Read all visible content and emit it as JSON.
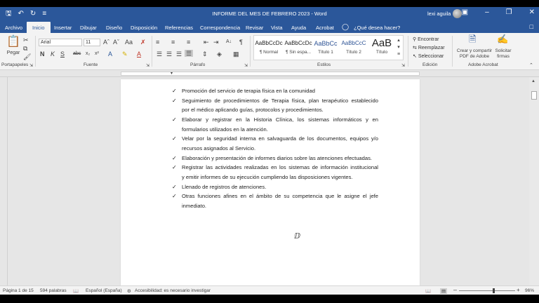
{
  "window": {
    "title": "INFORME DEL MES DE FEBRERO  2023  -  Word",
    "user": "lexi aguila"
  },
  "tabs": [
    "Archivo",
    "Inicio",
    "Insertar",
    "Dibujar",
    "Diseño",
    "Disposición",
    "Referencias",
    "Correspondencia",
    "Revisar",
    "Vista",
    "Ayuda",
    "Acrobat"
  ],
  "tell_me": "¿Qué desea hacer?",
  "ribbon": {
    "paste": "Pegar",
    "font_name": "Arial",
    "font_size": "11",
    "styles": [
      {
        "preview": "AaBbCcDc",
        "name": "¶ Normal"
      },
      {
        "preview": "AaBbCcDc",
        "name": "¶ Sin espa..."
      },
      {
        "preview": "AaBbCc",
        "name": "Título 1"
      },
      {
        "preview": "AaBbCcC",
        "name": "Título 2"
      },
      {
        "preview": "AaB",
        "name": "Título"
      }
    ],
    "edit": {
      "find": "Encontrar",
      "replace": "Reemplazar",
      "select": "Seleccionar"
    },
    "acrobat": {
      "create": "Crear y compartir",
      "create2": "PDF de Adobe",
      "request": "Solicitar",
      "request2": "firmas"
    },
    "groups": {
      "clipboard": "Portapapeles",
      "font": "Fuente",
      "paragraph": "Párrafo",
      "styles": "Estilos",
      "editing": "Edición",
      "adobe": "Adobe Acrobat"
    }
  },
  "document": {
    "bullets": [
      {
        "lines": [
          "Promoción del servicio de terapia física en la comunidad"
        ]
      },
      {
        "lines": [
          "Seguimiento de procedimientos de Terapia física, plan terapéutico establecido",
          "por el médico aplicando guías, protocolos y procedimientos."
        ]
      },
      {
        "lines": [
          "Elaborar y registrar en la Historia Clínica, los sistemas informáticos y en",
          "formularios utilizados en la atención."
        ]
      },
      {
        "lines": [
          "Velar por la seguridad interna en salvaguarda de los documentos, equipos y/o",
          "recursos asignados al Servicio."
        ]
      },
      {
        "lines": [
          "Elaboración y presentación de informes diarios sobre las atenciones efectuadas."
        ]
      },
      {
        "lines": [
          "Registrar las actividades realizadas en los sistemas de información institucional",
          "y emitir informes de su ejecución cumpliendo las disposiciones vigentes."
        ]
      },
      {
        "lines": [
          "Llenado de registros de atenciones."
        ]
      },
      {
        "lines": [
          "Otras funciones afines en el ámbito de su competencia que le asigne el jefe",
          "inmediato."
        ]
      }
    ]
  },
  "status": {
    "page": "Página 1 de 15",
    "words": "594 palabras",
    "language": "Español (España)",
    "accessibility": "Accesibilidad: es necesario investigar",
    "zoom": "96%"
  },
  "colors": {
    "accent": "#2b579a"
  }
}
